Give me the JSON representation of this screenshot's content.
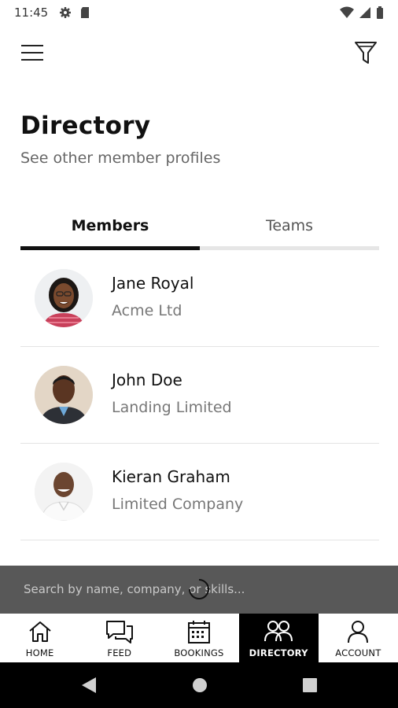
{
  "status_bar": {
    "time": "11:45"
  },
  "header": {
    "title": "Directory",
    "subtitle": "See other member profiles"
  },
  "tabs": [
    {
      "label": "Members",
      "active": true
    },
    {
      "label": "Teams",
      "active": false
    }
  ],
  "members": [
    {
      "name": "Jane Royal",
      "company": "Acme Ltd"
    },
    {
      "name": "John Doe",
      "company": "Landing Limited"
    },
    {
      "name": "Kieran Graham",
      "company": "Limited Company"
    }
  ],
  "search": {
    "placeholder": "Search by name, company, or skills..."
  },
  "bottom_nav": [
    {
      "label": "HOME",
      "icon": "home-icon",
      "active": false
    },
    {
      "label": "FEED",
      "icon": "chat-icon",
      "active": false
    },
    {
      "label": "BOOKINGS",
      "icon": "calendar-icon",
      "active": false
    },
    {
      "label": "DIRECTORY",
      "icon": "people-icon",
      "active": true
    },
    {
      "label": "ACCOUNT",
      "icon": "person-icon",
      "active": false
    }
  ],
  "colors": {
    "accent": "#000000",
    "search_bar": "#585858",
    "divider": "#e4e4e4"
  }
}
